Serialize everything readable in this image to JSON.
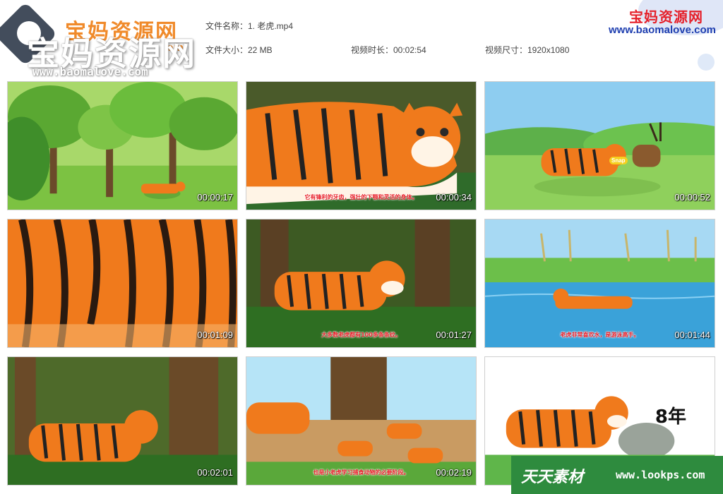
{
  "header": {
    "logo_left_cn": "宝妈资源网",
    "logo_left_url": "www.baomalove.com",
    "logo_left_url_partial": "om",
    "logo_right_cn": "宝妈资源网",
    "logo_right_url": "www.baomalove.com",
    "file_name": "文件名称：1. 老虎.mp4",
    "file_size": "文件大小：22 MB",
    "duration": "视频时长：00:02:54",
    "dimensions": "视频尺寸：1920x1080"
  },
  "thumbnails": [
    {
      "timestamp": "00:00:17",
      "subtitle": ""
    },
    {
      "timestamp": "00:00:34",
      "subtitle": "它有锋利的牙齿，强壮的下颚和灵活的身体。"
    },
    {
      "timestamp": "00:00:52",
      "subtitle": "",
      "badge": "Snap"
    },
    {
      "timestamp": "00:01:09",
      "subtitle": ""
    },
    {
      "timestamp": "00:01:27",
      "subtitle": "大多数老虎都有100多条条纹。"
    },
    {
      "timestamp": "00:01:44",
      "subtitle": "老虎非常喜欢水，是游泳高手。"
    },
    {
      "timestamp": "00:02:01",
      "subtitle": ""
    },
    {
      "timestamp": "00:02:19",
      "subtitle": "也是小老虎学习捕食动物的必要阶段。"
    },
    {
      "timestamp": "",
      "subtitle": "",
      "overlay_text": "8年"
    }
  ],
  "watermark": {
    "cn": "天天素材",
    "url": "www.lookps.com"
  },
  "colors": {
    "tiger_orange": "#f07a1c",
    "grass_green": "#4caf3a",
    "sky_blue": "#8ecdf0",
    "watermark_green": "#2e8b3e"
  }
}
